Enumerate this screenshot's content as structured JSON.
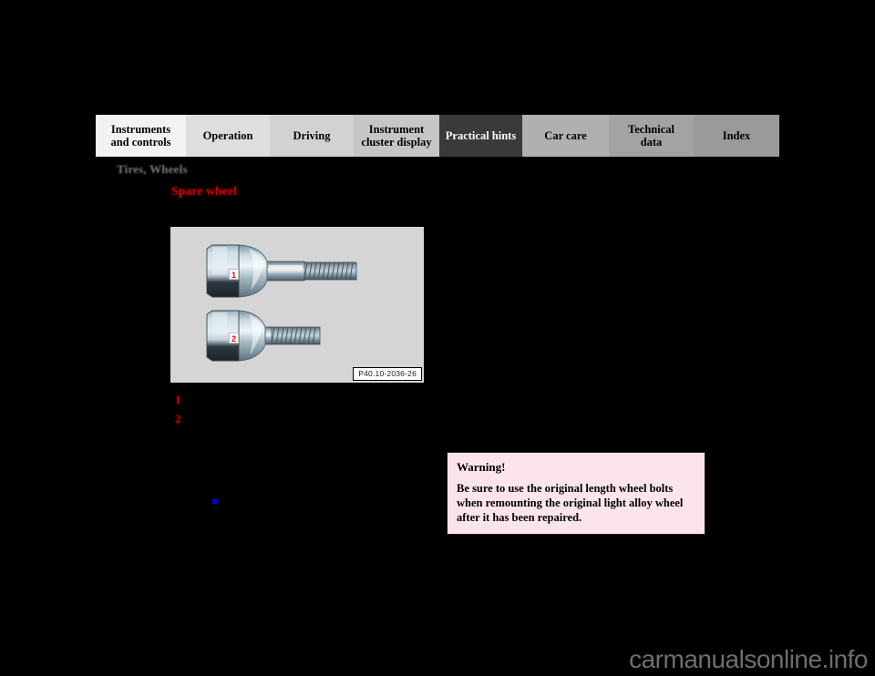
{
  "page": {
    "background_color": "#000000",
    "section_heading": "Tires, Wheels",
    "topic_heading": "Spare wheel",
    "watermark": "carmanualsonline.info"
  },
  "tab_bar": {
    "active_tab": "Practical hints",
    "tabs": [
      {
        "label": "Instruments\nand controls",
        "bg": "#f2f2f2",
        "text_color": "#000000",
        "width": 99,
        "active": false
      },
      {
        "label": "Operation",
        "bg": "#dedede",
        "text_color": "#000000",
        "width": 92,
        "active": false
      },
      {
        "label": "Driving",
        "bg": "#d2d2d2",
        "text_color": "#000000",
        "width": 92,
        "active": false
      },
      {
        "label": "Instrument\ncluster display",
        "bg": "#c6c6c6",
        "text_color": "#000000",
        "width": 94,
        "active": false
      },
      {
        "label": "Practical hints",
        "bg": "#3a3a3a",
        "text_color": "#ffffff",
        "width": 91,
        "active": true
      },
      {
        "label": "Car care",
        "bg": "#b0b0b0",
        "text_color": "#000000",
        "width": 95,
        "active": false
      },
      {
        "label": "Technical\ndata",
        "bg": "#a3a3a3",
        "text_color": "#000000",
        "width": 93,
        "active": false
      },
      {
        "label": "Index",
        "bg": "#9a9a9a",
        "text_color": "#000000",
        "width": 94,
        "active": false
      }
    ]
  },
  "illustration": {
    "caption": "P40.10-2036-26",
    "background_color": "#d5d5d5",
    "callouts": [
      {
        "number": "1",
        "describes": "long wheel bolt"
      },
      {
        "number": "2",
        "describes": "short wheel bolt"
      }
    ]
  },
  "legend": {
    "items": [
      {
        "number": "1",
        "text": ""
      },
      {
        "number": "2",
        "text": ""
      }
    ]
  },
  "bullet": {
    "marker_color": "#0000f0",
    "text": ""
  },
  "warning": {
    "title": "Warning!",
    "body": "Be sure to use the original length wheel bolts when remounting the original light alloy wheel after it has been repaired.",
    "background_color": "#fbe4ec",
    "border_color": "#1a1a1a"
  }
}
